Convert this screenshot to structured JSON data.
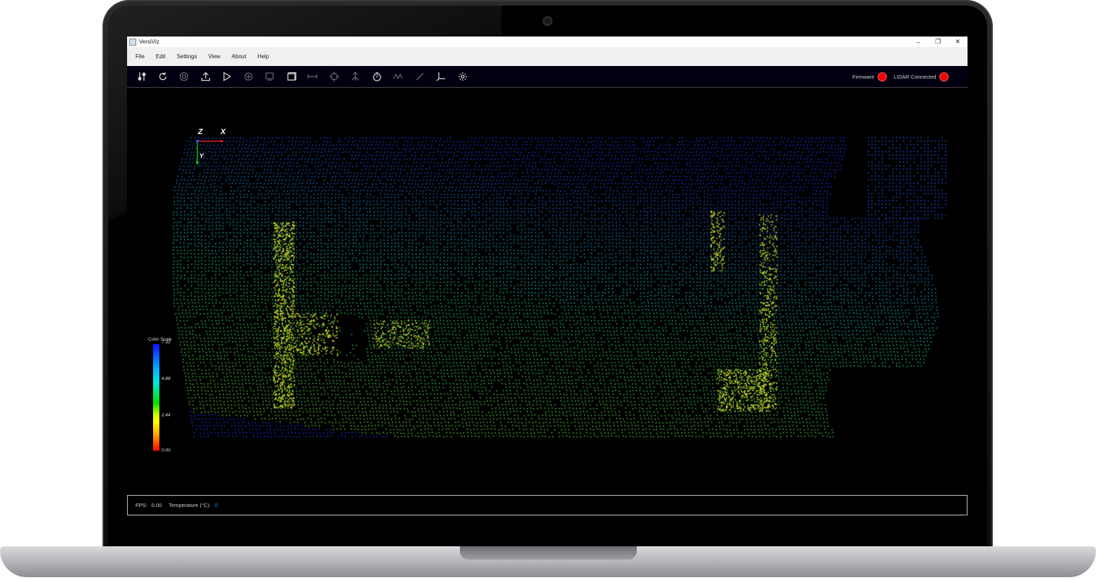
{
  "window": {
    "title": "VersiViz",
    "controls": {
      "minimize": "–",
      "restore": "❐",
      "close": "✕"
    }
  },
  "menu": [
    "File",
    "Edit",
    "Settings",
    "View",
    "About",
    "Help"
  ],
  "toolbar": {
    "tools": [
      {
        "icon": "settings-adjust-icon"
      },
      {
        "icon": "refresh-icon"
      },
      {
        "icon": "record-icon"
      },
      {
        "icon": "export-icon"
      },
      {
        "icon": "play-icon"
      },
      {
        "icon": "camera-view-icon"
      },
      {
        "icon": "frame-icon"
      },
      {
        "icon": "crop-box-icon"
      },
      {
        "icon": "measure-icon"
      },
      {
        "icon": "target-icon"
      },
      {
        "icon": "vertical-axis-icon"
      },
      {
        "icon": "timer-icon"
      },
      {
        "icon": "wave-icon"
      },
      {
        "icon": "ruler-icon"
      },
      {
        "icon": "axes-icon"
      },
      {
        "icon": "gear-icon"
      }
    ],
    "status": {
      "firmware_label": "Firmware",
      "lidar_label": "LIDAR Connected",
      "indicator_color": "#ff0000"
    }
  },
  "viewport": {
    "axes": {
      "z": "Z",
      "x": "X",
      "y": "Y"
    },
    "color_scale": {
      "title": "Color Scale",
      "ticks": [
        "7.32",
        "4.88",
        "2.44",
        "0.00"
      ],
      "gradient": [
        "#1010ff",
        "#00aaff",
        "#00e8e0",
        "#00e000",
        "#ffff00",
        "#ff9a00",
        "#ff0000"
      ]
    }
  },
  "statusbar": {
    "fps_label": "FPS:",
    "fps_value": "0.00",
    "temp_label": "Temperature (°C):",
    "temp_value": "0"
  }
}
